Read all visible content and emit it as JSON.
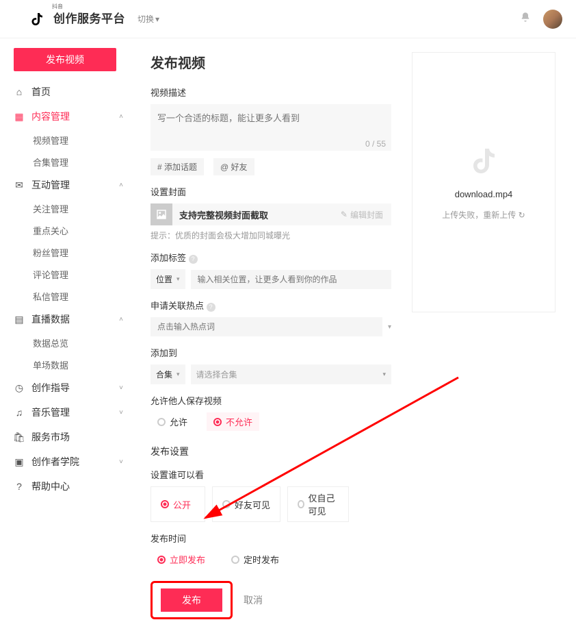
{
  "header": {
    "brand_name": "创作服务平台",
    "brand_sub": "抖音",
    "switch_label": "切换"
  },
  "sidebar": {
    "publish_btn": "发布视频",
    "items": [
      {
        "icon": "home",
        "label": "首页"
      },
      {
        "icon": "grid",
        "label": "内容管理",
        "active": true,
        "expandable": true,
        "children": [
          {
            "label": "视频管理"
          },
          {
            "label": "合集管理"
          }
        ]
      },
      {
        "icon": "chat",
        "label": "互动管理",
        "expandable": true,
        "children": [
          {
            "label": "关注管理"
          },
          {
            "label": "重点关心"
          },
          {
            "label": "粉丝管理"
          },
          {
            "label": "评论管理"
          },
          {
            "label": "私信管理"
          }
        ]
      },
      {
        "icon": "bars",
        "label": "直播数据",
        "expandable": true,
        "children": [
          {
            "label": "数据总览"
          },
          {
            "label": "单场数据"
          }
        ]
      },
      {
        "icon": "compass",
        "label": "创作指导",
        "expandable": true
      },
      {
        "icon": "music",
        "label": "音乐管理",
        "expandable": true
      },
      {
        "icon": "cart",
        "label": "服务市场"
      },
      {
        "icon": "book",
        "label": "创作者学院",
        "expandable": true
      },
      {
        "icon": "help",
        "label": "帮助中心"
      }
    ]
  },
  "form": {
    "page_title": "发布视频",
    "desc_label": "视频描述",
    "desc_placeholder": "写一个合适的标题，能让更多人看到",
    "desc_counter": "0 / 55",
    "topic_chip": "# 添加话题",
    "mention_chip": "@ 好友",
    "cover_label": "设置封面",
    "cover_text": "支持完整视频封面截取",
    "cover_edit": "编辑封面",
    "cover_hint": "提示：优质的封面会极大增加同城曝光",
    "tag_label": "添加标签",
    "tag_select": "位置",
    "tag_placeholder": "输入相关位置，让更多人看到你的作品",
    "hotspot_label": "申请关联热点",
    "hotspot_placeholder": "点击输入热点词",
    "addto_label": "添加到",
    "addto_select": "合集",
    "addto_placeholder": "请选择合集",
    "allowsave_label": "允许他人保存视频",
    "allowsave_yes": "允许",
    "allowsave_no": "不允许",
    "publish_section": "发布设置",
    "visibility_label": "设置谁可以看",
    "vis_public": "公开",
    "vis_friends": "好友可见",
    "vis_self": "仅自己可见",
    "time_label": "发布时间",
    "time_now": "立即发布",
    "time_sched": "定时发布",
    "submit": "发布",
    "cancel": "取消"
  },
  "preview": {
    "filename": "download.mp4",
    "status": "上传失败，重新上传 ↻"
  }
}
